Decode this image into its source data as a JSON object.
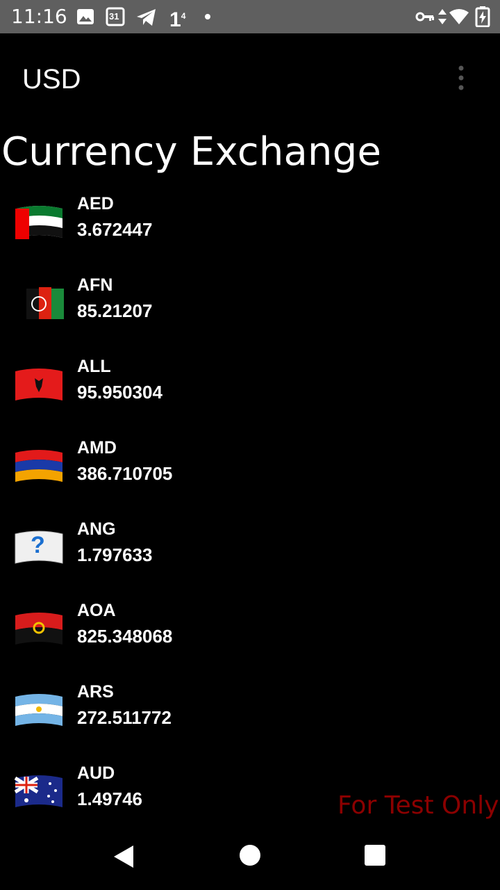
{
  "status_bar": {
    "time": "11:16",
    "icons": [
      "image-icon",
      "calendar-icon",
      "telegram-icon",
      "notification-count-icon",
      "dot-icon",
      "vpn-key-icon",
      "data-arrows-icon",
      "wifi-icon",
      "battery-charging-icon"
    ],
    "calendar_day": "31",
    "notification_count": "1",
    "notification_sup": "4"
  },
  "app_bar": {
    "title": "USD"
  },
  "page_title": "Currency Exchange",
  "rates": [
    {
      "code": "AED",
      "value": "3.672447",
      "flag": "uae-flag-icon"
    },
    {
      "code": "AFN",
      "value": "85.21207",
      "flag": "afghanistan-flag-icon"
    },
    {
      "code": "ALL",
      "value": "95.950304",
      "flag": "albania-flag-icon"
    },
    {
      "code": "AMD",
      "value": "386.710705",
      "flag": "armenia-flag-icon"
    },
    {
      "code": "ANG",
      "value": "1.797633",
      "flag": "unknown-flag-icon"
    },
    {
      "code": "AOA",
      "value": "825.348068",
      "flag": "angola-flag-icon"
    },
    {
      "code": "ARS",
      "value": "272.511772",
      "flag": "argentina-flag-icon"
    },
    {
      "code": "AUD",
      "value": "1.49746",
      "flag": "australia-flag-icon"
    }
  ],
  "unknown_flag_glyph": "?",
  "watermark": "For Test Only",
  "colors": {
    "status_bar": "#5f5f5f",
    "background": "#000000",
    "watermark": "#8b0000"
  }
}
